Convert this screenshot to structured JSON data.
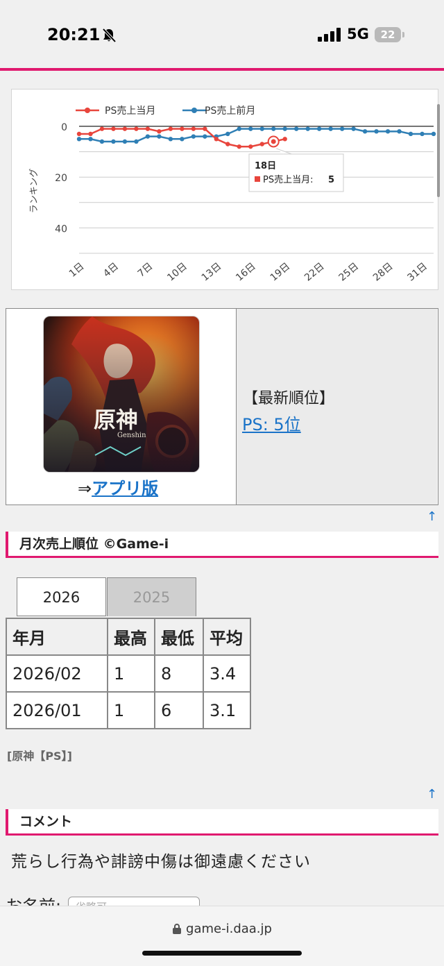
{
  "status": {
    "time": "20:21",
    "network": "5G",
    "battery": "22"
  },
  "chart_data": {
    "type": "line",
    "xlabel": "",
    "ylabel": "ランキング",
    "y_reversed": true,
    "ylim": [
      0,
      50
    ],
    "y_ticks": [
      "0",
      "20",
      "40"
    ],
    "x": [
      1,
      2,
      3,
      4,
      5,
      6,
      7,
      8,
      9,
      10,
      11,
      12,
      13,
      14,
      15,
      16,
      17,
      18,
      19,
      20,
      21,
      22,
      23,
      24,
      25,
      26,
      27,
      28,
      29,
      30,
      31
    ],
    "x_tick_labels": [
      "1日",
      "4日",
      "7日",
      "10日",
      "13日",
      "16日",
      "19日",
      "22日",
      "25日",
      "28日",
      "31日"
    ],
    "legend_position": "top",
    "series": [
      {
        "name": "PS売上当月",
        "color": "#e8453c",
        "values": [
          3,
          3,
          1,
          1,
          1,
          1,
          1,
          2,
          1,
          1,
          1,
          1,
          5,
          7,
          8,
          8,
          7,
          6,
          5
        ]
      },
      {
        "name": "PS売上前月",
        "color": "#2f7fb5",
        "values": [
          5,
          5,
          6,
          6,
          6,
          6,
          4,
          4,
          5,
          5,
          4,
          4,
          4,
          3,
          1,
          1,
          1,
          1,
          1,
          1,
          1,
          1,
          1,
          1,
          1,
          2,
          2,
          2,
          2,
          3,
          3,
          3
        ]
      }
    ],
    "tooltip": {
      "title": "18日",
      "label": "PS売上当月:",
      "value": "5"
    }
  },
  "game": {
    "app_arrow": "⇒",
    "app_link": "アプリ版",
    "latest_title": "【最新順位】",
    "latest_value": "PS: 5位"
  },
  "up_arrow": "↑",
  "monthly": {
    "heading": "月次売上順位 ©Game-i",
    "tabs": [
      "2026",
      "2025"
    ],
    "columns": [
      "年月",
      "最高",
      "最低",
      "平均"
    ],
    "rows": [
      [
        "2026/02",
        "1",
        "8",
        "3.4"
      ],
      [
        "2026/01",
        "1",
        "6",
        "3.1"
      ]
    ],
    "tag": "[原神【PS】]"
  },
  "comment": {
    "heading": "コメント",
    "notice": "荒らし行為や誹謗中傷は御遠慮ください",
    "name_label": "お名前:",
    "name_placeholder": "省略可"
  },
  "url": "game-i.daa.jp",
  "colors": {
    "accent": "#e0196f",
    "link": "#1a73c8"
  }
}
